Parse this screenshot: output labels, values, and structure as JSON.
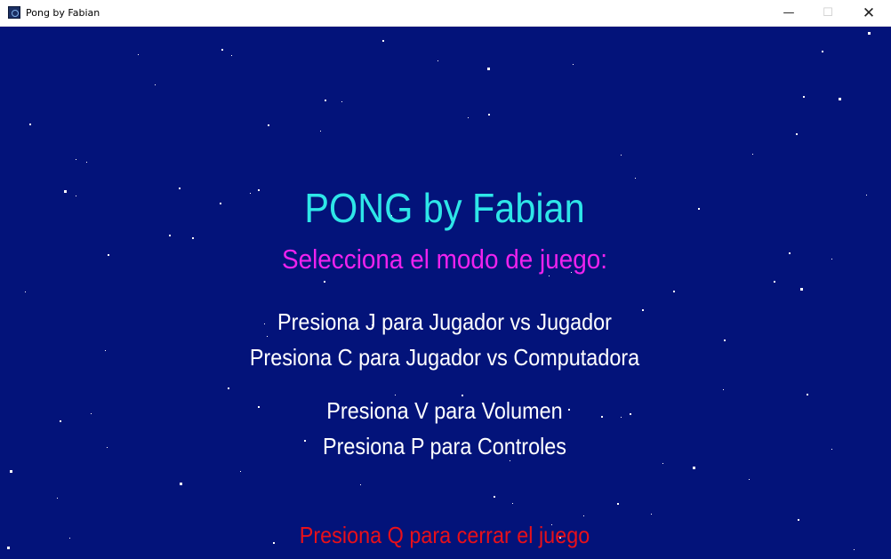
{
  "window": {
    "title": "Pong by Fabian",
    "controls": {
      "minimize": "—",
      "maximize": "☐",
      "close": "✕"
    }
  },
  "menu": {
    "title": "PONG by Fabian",
    "subtitle": "Selecciona el modo de juego:",
    "option_pvp": "Presiona J para Jugador vs Jugador",
    "option_pvc": "Presiona C para Jugador vs Computadora",
    "option_volume": "Presiona V para Volumen",
    "option_controls": "Presiona P para Controles",
    "option_quit": "Presiona Q para cerrar el juego"
  },
  "colors": {
    "background": "#03137a",
    "title": "#2ee6e8",
    "subtitle": "#ee22ee",
    "options": "#ffffff",
    "quit": "#e8101a",
    "stars": "#ffffff"
  },
  "icons": {
    "app": "pong-app-icon",
    "minimize": "minimize-icon",
    "maximize": "maximize-icon",
    "close": "close-icon"
  }
}
